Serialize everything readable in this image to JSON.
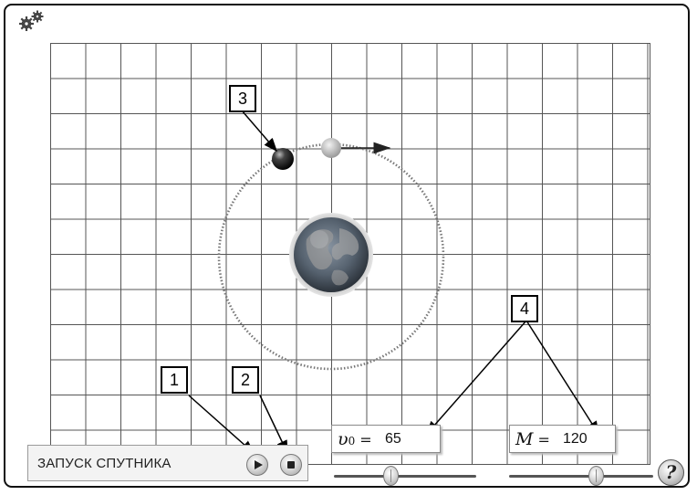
{
  "callouts": [
    "3",
    "1",
    "2",
    "4"
  ],
  "launch": {
    "label": "ЗАПУСК СПУТНИКА"
  },
  "velocity": {
    "symbol": "υ",
    "subscript": "0",
    "eq": " =",
    "value": "65"
  },
  "mass": {
    "symbol": "M",
    "eq": " =",
    "value": "120"
  },
  "help": {
    "label": "?"
  },
  "sliders": {
    "velocity_level": 0.4,
    "mass_level": 0.6
  },
  "icons": {
    "gears": "gears-icon",
    "play": "play-icon",
    "stop": "stop-icon",
    "earth": "earth-icon",
    "satellite": "satellite-icon"
  },
  "colors": {
    "grid": "#555555",
    "orbit": "#777777",
    "earth_ocean": "#4d5f74",
    "earth_land": "#8a8a8a"
  }
}
